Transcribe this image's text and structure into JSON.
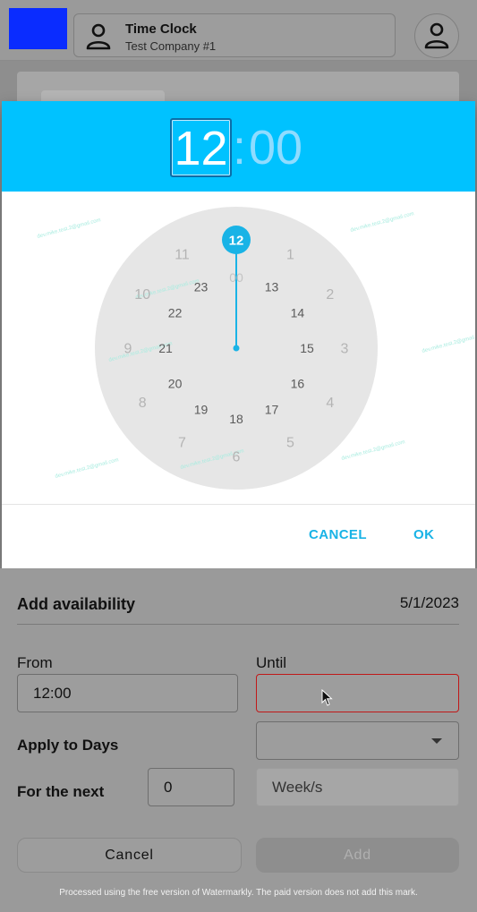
{
  "app": {
    "title": "Time Clock",
    "company": "Test Company #1",
    "logo_color": "#0a2cff"
  },
  "time_picker": {
    "hour": "12",
    "separator": ":",
    "minute": "00",
    "accent_color": "#00c2ff",
    "outer_ring": [
      "1",
      "2",
      "3",
      "4",
      "5",
      "6",
      "7",
      "8",
      "9",
      "10",
      "11",
      "12"
    ],
    "inner_ring": [
      "13",
      "14",
      "15",
      "16",
      "17",
      "18",
      "19",
      "20",
      "21",
      "22",
      "23",
      "00"
    ],
    "selected_hour": "12",
    "cancel_label": "CANCEL",
    "ok_label": "OK",
    "watermark": "dev.mike.test.2@gmail.com"
  },
  "availability": {
    "title": "Add availability",
    "date": "5/1/2023",
    "from_label": "From",
    "from_value": "12:00",
    "until_label": "Until",
    "until_value": "",
    "apply_label": "Apply to Days",
    "apply_value": "",
    "for_next_label": "For the next",
    "for_next_value": "0",
    "unit_value": "Week/s",
    "cancel_button": "Cancel",
    "add_button": "Add"
  },
  "footer_note": "Processed using the free version of Watermarkly. The paid version does not add this mark."
}
